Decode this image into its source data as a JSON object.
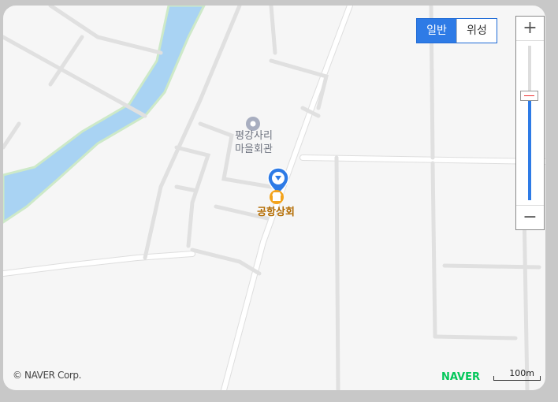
{
  "map": {
    "poi_village": {
      "icon": "village-hall-pin-icon",
      "label_line1": "평강사리",
      "label_line2": "마을회관"
    },
    "poi_store": {
      "icon": "store-icon",
      "label": "공항상회"
    },
    "marker": {
      "icon": "location-marker-icon"
    }
  },
  "controls": {
    "maptype": {
      "normal": "일반",
      "satellite": "위성",
      "selected": "일반"
    },
    "zoom": {
      "plus": "+",
      "minus": "−",
      "level_fraction": 0.68
    }
  },
  "footer": {
    "copyright": "© NAVER Corp.",
    "brand": "NAVER",
    "scale": "100m"
  },
  "colors": {
    "accent": "#2e7be6",
    "river": "#a9d3f3",
    "brand_green": "#03c75a",
    "poi_orange": "#f3a31c"
  }
}
